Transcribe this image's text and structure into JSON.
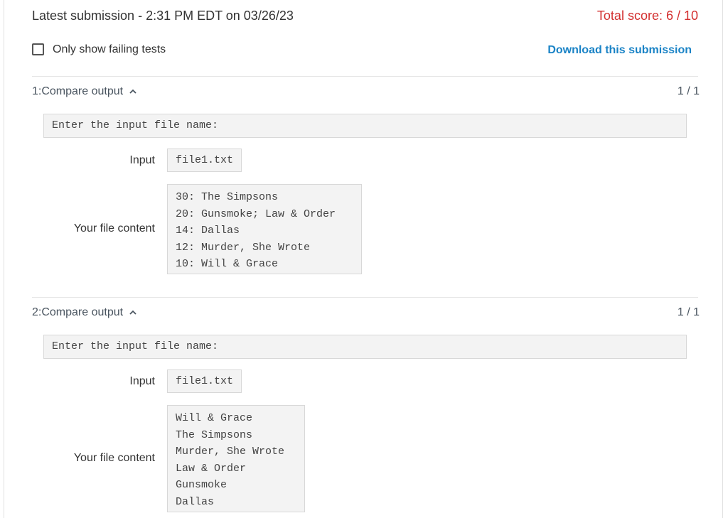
{
  "header": {
    "latest_submission": "Latest submission - 2:31 PM EDT on 03/26/23",
    "total_score": "Total score: 6 / 10"
  },
  "options": {
    "only_failing_label": "Only show failing tests",
    "only_failing_checked": false,
    "download_label": "Download this submission"
  },
  "tests": [
    {
      "title": "1:Compare output",
      "score": "1 / 1",
      "prompt": "Enter the input file name:",
      "input_label": "Input",
      "input_value": "file1.txt",
      "content_label": "Your file content",
      "content": "30: The Simpsons\n20: Gunsmoke; Law & Order\n14: Dallas\n12: Murder, She Wrote\n10: Will & Grace"
    },
    {
      "title": "2:Compare output",
      "score": "1 / 1",
      "prompt": "Enter the input file name:",
      "input_label": "Input",
      "input_value": "file1.txt",
      "content_label": "Your file content",
      "content": "Will & Grace\nThe Simpsons\nMurder, She Wrote\nLaw & Order\nGunsmoke\nDallas"
    }
  ],
  "colors": {
    "score_red": "#d32f2f",
    "link_blue": "#1a83c6",
    "code_bg": "#f3f3f3"
  },
  "icons": {
    "chevron": "chevron-up-icon"
  }
}
